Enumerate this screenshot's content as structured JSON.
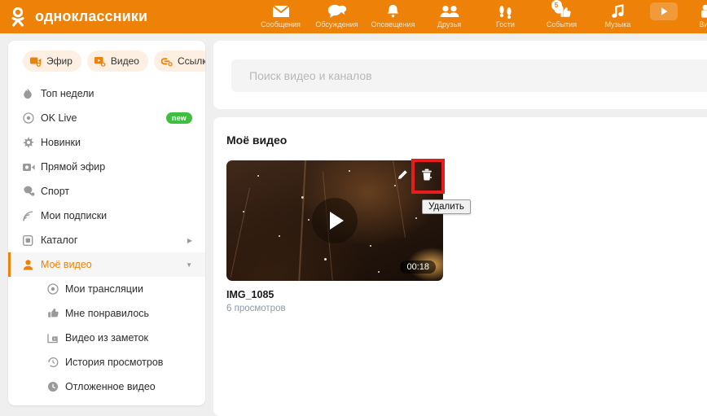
{
  "header": {
    "brand": "одноклассники",
    "logo_icon": "ok-logo-icon",
    "nav": [
      {
        "label": "Сообщения",
        "icon": "envelope-icon",
        "name": "nav-messages"
      },
      {
        "label": "Обсуждения",
        "icon": "chat-bubbles-icon",
        "name": "nav-discussions"
      },
      {
        "label": "Оповещения",
        "icon": "bell-icon",
        "name": "nav-notifications"
      },
      {
        "label": "Друзья",
        "icon": "people-icon",
        "name": "nav-friends"
      },
      {
        "label": "Гости",
        "icon": "footprints-icon",
        "name": "nav-guests"
      },
      {
        "label": "События",
        "icon": "thumbs-up-icon",
        "name": "nav-events",
        "badge": "5"
      },
      {
        "label": "Музыка",
        "icon": "music-note-icon",
        "name": "nav-music"
      },
      {
        "label": "",
        "icon": "play-button-icon",
        "name": "nav-play"
      },
      {
        "label": "Видео",
        "icon": "video-camera-icon",
        "name": "nav-video"
      }
    ]
  },
  "sidebar": {
    "actions": [
      {
        "label": "Эфир",
        "icon": "live-camera-plus-icon",
        "name": "create-live-button"
      },
      {
        "label": "Видео",
        "icon": "video-plus-icon",
        "name": "upload-video-button"
      },
      {
        "label": "Ссылка",
        "icon": "link-plus-icon",
        "name": "add-link-button"
      }
    ],
    "menu": [
      {
        "label": "Топ недели",
        "icon": "flame-icon",
        "name": "sidebar-item-top-week"
      },
      {
        "label": "OK Live",
        "icon": "live-ring-icon",
        "name": "sidebar-item-ok-live",
        "badge": "new"
      },
      {
        "label": "Новинки",
        "icon": "sparkle-icon",
        "name": "sidebar-item-new"
      },
      {
        "label": "Прямой эфир",
        "icon": "camcorder-icon",
        "name": "sidebar-item-broadcast"
      },
      {
        "label": "Спорт",
        "icon": "sport-icon",
        "name": "sidebar-item-sport"
      },
      {
        "label": "Мои подписки",
        "icon": "rss-icon",
        "name": "sidebar-item-subscriptions"
      },
      {
        "label": "Каталог",
        "icon": "catalog-icon",
        "name": "sidebar-item-catalog",
        "caret": "▶"
      },
      {
        "label": "Моё видео",
        "icon": "person-icon",
        "name": "sidebar-item-my-video",
        "caret": "▼",
        "active": true
      },
      {
        "label": "Мои трансляции",
        "icon": "live-ring-icon",
        "name": "sidebar-item-my-streams",
        "sub": true
      },
      {
        "label": "Мне понравилось",
        "icon": "thumbs-up-icon",
        "name": "sidebar-item-liked",
        "sub": true
      },
      {
        "label": "Видео из заметок",
        "icon": "note-video-icon",
        "name": "sidebar-item-video-from-notes",
        "sub": true
      },
      {
        "label": "История просмотров",
        "icon": "history-icon",
        "name": "sidebar-item-watch-history",
        "sub": true
      },
      {
        "label": "Отложенное видео",
        "icon": "clock-icon",
        "name": "sidebar-item-saved-video",
        "sub": true
      }
    ]
  },
  "search": {
    "placeholder": "Поиск видео и каналов",
    "value": ""
  },
  "main": {
    "section_title": "Моё видео",
    "video": {
      "title": "IMG_1085",
      "views": "6 просмотров",
      "duration": "00:18",
      "edit_icon": "pencil-icon",
      "delete_icon": "trash-icon",
      "play_icon": "play-icon"
    }
  },
  "annotation": {
    "tooltip": "Удалить",
    "highlight_color": "#e81c1c"
  },
  "colors": {
    "brand_orange": "#ee8208",
    "badge_green": "#3fbf3f",
    "page_bg": "#efefef"
  }
}
